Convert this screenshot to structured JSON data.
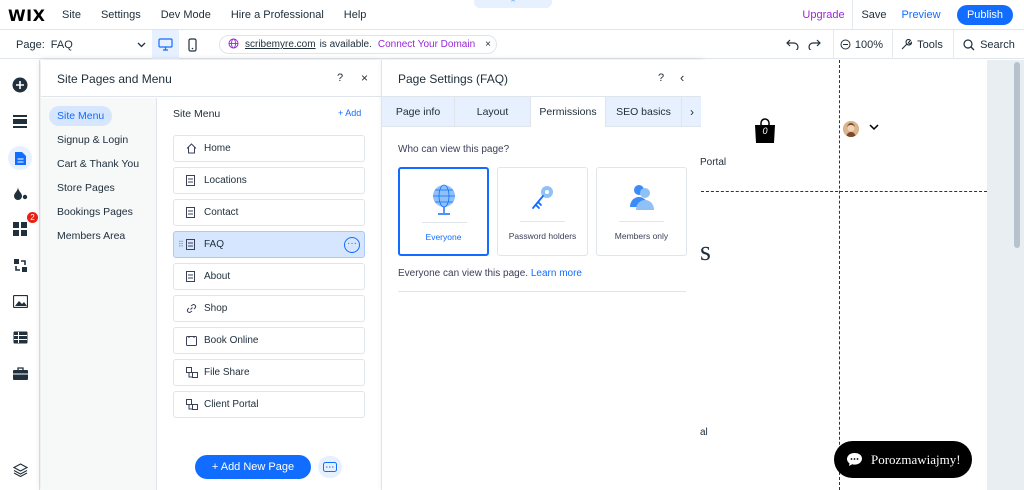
{
  "topbar": {
    "logo": "WIX",
    "menu": [
      "Site",
      "Settings",
      "Dev Mode",
      "Hire a Professional",
      "Help"
    ],
    "center_tab": "^",
    "upgrade": "Upgrade",
    "save": "Save",
    "preview": "Preview",
    "publish": "Publish"
  },
  "subbar": {
    "page_label": "Page:",
    "page_value": "FAQ",
    "domain": "scribemyre.com",
    "available": "is available.",
    "connect": "Connect Your Domain",
    "close_x": "×",
    "zoom": "100%",
    "tools": "Tools",
    "search": "Search"
  },
  "rail": {
    "items": [
      "add-icon",
      "sections-icon",
      "pages-icon",
      "design-icon",
      "apps-icon",
      "business-icon",
      "media-icon",
      "cms-icon",
      "portfolio-icon",
      "layers-icon"
    ],
    "apps_badge": "2"
  },
  "pages_panel": {
    "title": "Site Pages and Menu",
    "help": "?",
    "close": "×",
    "categories": [
      "Site Menu",
      "Signup & Login",
      "Cart & Thank You",
      "Store Pages",
      "Bookings Pages",
      "Members Area"
    ],
    "list_title": "Site Menu",
    "add_label": "+ Add",
    "pages": [
      {
        "label": "Home",
        "icon": "home-icon"
      },
      {
        "label": "Locations",
        "icon": "page-icon"
      },
      {
        "label": "Contact",
        "icon": "page-icon"
      },
      {
        "label": "FAQ",
        "icon": "page-icon"
      },
      {
        "label": "About",
        "icon": "page-icon"
      },
      {
        "label": "Shop",
        "icon": "link-icon"
      },
      {
        "label": "Book Online",
        "icon": "booking-icon"
      },
      {
        "label": "File Share",
        "icon": "fileshare-icon"
      },
      {
        "label": "Client Portal",
        "icon": "fileshare-icon"
      }
    ],
    "selected_more": "···",
    "add_page": "+ Add New Page"
  },
  "settings": {
    "title": "Page Settings (FAQ)",
    "help": "?",
    "back": "‹",
    "tabs": [
      "Page info",
      "Layout",
      "Permissions",
      "SEO basics"
    ],
    "active_tab": "Permissions",
    "tab_next": "›",
    "question": "Who can view this page?",
    "cards": [
      "Everyone",
      "Password holders",
      "Members only"
    ],
    "description": "Everyone can view this page.",
    "learn_more": "Learn more"
  },
  "canvas": {
    "bag_count": "0",
    "portal_text_1": "Portal",
    "big_text": "s",
    "portal_text_2": "al",
    "chat_label": "Porozmawiajmy!"
  },
  "colors": {
    "accent": "#116dff",
    "upgrade": "#9a27d5",
    "selected_bg": "#d6e6fe",
    "badge": "#e62214"
  }
}
